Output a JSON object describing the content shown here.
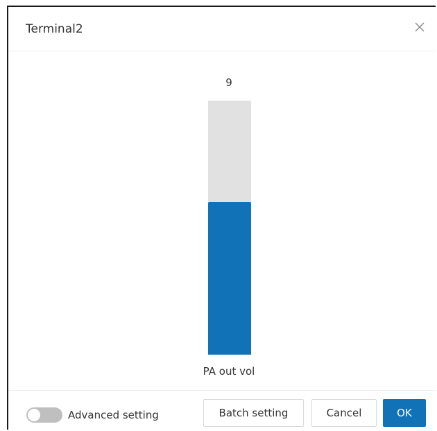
{
  "dialog": {
    "title": "Terminal2",
    "close_icon": "close-icon"
  },
  "slider": {
    "value_text": "9",
    "fill_fraction": 0.6,
    "label": "PA out vol"
  },
  "footer": {
    "toggle_label": "Advanced setting",
    "toggle_on": false,
    "batch_label": "Batch setting",
    "cancel_label": "Cancel",
    "ok_label": "OK"
  },
  "colors": {
    "accent": "#1172b8",
    "track": "#e1e1e1",
    "toggle_off": "#bfbfbf"
  }
}
